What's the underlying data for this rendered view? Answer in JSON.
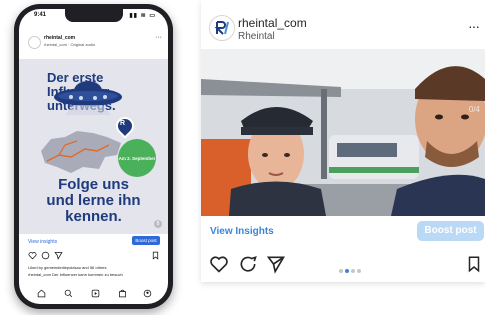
{
  "phone": {
    "status_time": "9:41",
    "status_icons": "▮▮ ≋ ▭",
    "account_name": "rheintal_com",
    "account_sub": "rheintal_com · Original audio",
    "more": "···",
    "post_text_lines": [
      "Der erste",
      "Influencer",
      "unterwegs."
    ],
    "date_badge": "Am 2. September",
    "cta_lines": [
      "Folge uns",
      "und lerne ihn",
      "kennen."
    ],
    "page_badge": "8",
    "view_insights": "View insights",
    "boost_post": "Boost post",
    "liked_by": "Liked by gemeindediepoldsau and 56 others",
    "caption": "rheintal_com Der Influencer kann kommen zu besuch",
    "nav_icons": [
      "home-icon",
      "search-icon",
      "reels-icon",
      "shop-icon",
      "profile-icon"
    ]
  },
  "card": {
    "account_name": "rheintal_com",
    "location": "Rheintal",
    "more": "···",
    "photo_counter": "0/4",
    "view_insights": "View Insights",
    "boost_post": "Boost post",
    "carousel_dots": 4,
    "active_dot": 1
  },
  "colors": {
    "brand_navy": "#1f3b7d",
    "badge_green": "#4bb05a",
    "insights_blue": "#3b85d9",
    "boost_light": "#b9d9f6"
  }
}
